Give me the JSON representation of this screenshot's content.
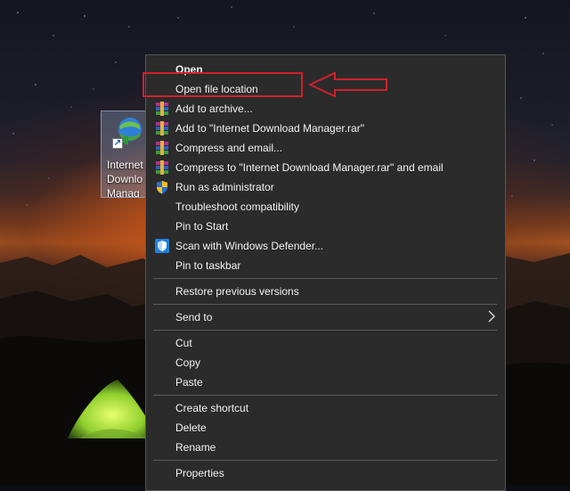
{
  "desktop": {
    "icon": {
      "name_lines": [
        "Internet",
        "Downlo",
        "Manag"
      ],
      "icon_name": "idm-globe-icon",
      "shortcut_icon": "shortcut-arrow-icon"
    }
  },
  "context_menu": {
    "groups": [
      {
        "items": [
          {
            "label": "Open",
            "bold": true,
            "icon": ""
          },
          {
            "label": "Open file location",
            "icon": ""
          },
          {
            "label": "Add to archive...",
            "icon": "winrar-icon"
          },
          {
            "label": "Add to \"Internet Download Manager.rar\"",
            "icon": "winrar-icon"
          },
          {
            "label": "Compress and email...",
            "icon": "winrar-icon"
          },
          {
            "label": "Compress to \"Internet Download Manager.rar\" and email",
            "icon": "winrar-icon"
          },
          {
            "label": "Run as administrator",
            "icon": "uac-shield-icon"
          },
          {
            "label": "Troubleshoot compatibility",
            "icon": ""
          },
          {
            "label": "Pin to Start",
            "icon": ""
          },
          {
            "label": "Scan with Windows Defender...",
            "icon": "windows-defender-icon"
          },
          {
            "label": "Pin to taskbar",
            "icon": ""
          }
        ]
      },
      {
        "items": [
          {
            "label": "Restore previous versions",
            "icon": ""
          }
        ]
      },
      {
        "items": [
          {
            "label": "Send to",
            "icon": "",
            "submenu_icon": "chevron-right-icon"
          }
        ]
      },
      {
        "items": [
          {
            "label": "Cut"
          },
          {
            "label": "Copy"
          },
          {
            "label": "Paste"
          }
        ]
      },
      {
        "items": [
          {
            "label": "Create shortcut"
          },
          {
            "label": "Delete"
          },
          {
            "label": "Rename"
          }
        ]
      },
      {
        "items": [
          {
            "label": "Properties"
          }
        ]
      }
    ]
  },
  "annotation": {
    "highlight_color": "#d0202a",
    "highlighted_item": "Open file location",
    "arrow_icon": "left-arrow-annotation-icon"
  }
}
